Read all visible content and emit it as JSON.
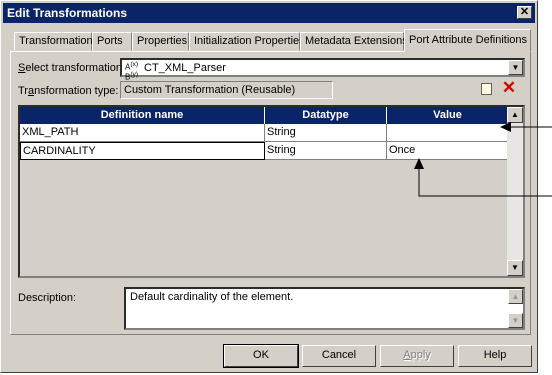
{
  "window": {
    "title": "Edit Transformations",
    "close_glyph": "✕"
  },
  "tabs": [
    {
      "label": "Transformation",
      "active": false
    },
    {
      "label": "Ports",
      "active": false
    },
    {
      "label": "Properties",
      "active": false
    },
    {
      "label": "Initialization Properties",
      "active": false
    },
    {
      "label": "Metadata Extensions",
      "active": false
    },
    {
      "label": "Port Attribute Definitions",
      "active": true
    }
  ],
  "select_transformation": {
    "label_prefix": "",
    "label_mnemonic": "S",
    "label_rest": "elect transformation:",
    "icon": "transformation-icon",
    "icon_text": "A(x)\nB(y)",
    "value": "CT_XML_Parser"
  },
  "transformation_type": {
    "label_prefix": "Tr",
    "label_mnemonic": "a",
    "label_rest": "nsformation type:",
    "value": "Custom Transformation (Reusable)"
  },
  "toolbar": {
    "new_icon": "new-row-icon",
    "delete_icon": "delete-icon",
    "delete_glyph": "✕"
  },
  "grid": {
    "columns": [
      "Definition name",
      "Datatype",
      "Value"
    ],
    "rows": [
      {
        "name": "XML_PATH",
        "datatype": "String",
        "value": ""
      },
      {
        "name": "CARDINALITY",
        "datatype": "String",
        "value": "Once"
      }
    ]
  },
  "description": {
    "label": "Description:",
    "value": "Default cardinality of the element."
  },
  "buttons": {
    "ok": "OK",
    "cancel": "Cancel",
    "apply": "Apply",
    "apply_mnemonic": "A",
    "apply_rest": "pply",
    "help": "Help"
  },
  "colors": {
    "titlebar": "#0a246a",
    "dialog": "#d4d0c8",
    "header": "#0a246a",
    "delete": "#d40000"
  }
}
